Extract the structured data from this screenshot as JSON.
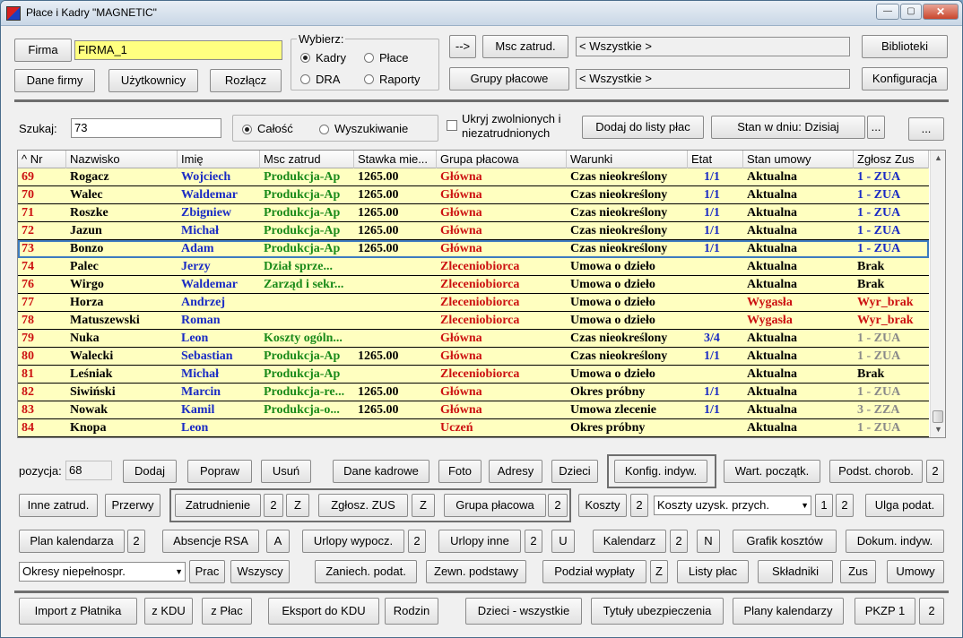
{
  "window": {
    "title": "Płace i Kadry \"MAGNETIC\"",
    "min": "—",
    "max": "▢",
    "close": "✕"
  },
  "top": {
    "firma_label": "Firma",
    "firma_value": "FIRMA_1",
    "dane_firmy": "Dane firmy",
    "uzytkownicy": "Użytkownicy",
    "rozlacz": "Rozłącz",
    "wybierz_label": "Wybierz:",
    "radio_kadry": "Kadry",
    "radio_place": "Płace",
    "radio_dra": "DRA",
    "radio_raporty": "Raporty",
    "arrow_btn": "-->",
    "msc_zatrud": "Msc zatrud.",
    "msc_value": "< Wszystkie >",
    "grupy_placowe": "Grupy płacowe",
    "grupy_value": "< Wszystkie >",
    "biblioteki": "Biblioteki",
    "konfiguracja": "Konfiguracja"
  },
  "search": {
    "label": "Szukaj:",
    "value": "73",
    "radio_calosc": "Całość",
    "radio_wyszukiwanie": "Wyszukiwanie",
    "ukryj_line1": "Ukryj zwolnionych i",
    "ukryj_line2": "niezatrudnionych",
    "dodaj_listy": "Dodaj do listy płac",
    "stan_w_dniu": "Stan w dniu: Dzisiaj",
    "dots1": "...",
    "dots2": "..."
  },
  "colors": {
    "nr": "#cc1111",
    "nazwisko": "#000000",
    "imie": "#1a2bc4",
    "msc": "#1a8a1a",
    "grupa": "#cc1111",
    "warunki": "#000000",
    "etat": "#1a2bc4",
    "stan_akt": "#000000",
    "stan_wyg": "#cc1111",
    "zus_blue": "#1a2bc4",
    "zus_gray": "#8a8a8a",
    "zus_black": "#000000",
    "zus_red": "#cc1111",
    "row_bg": "#ffffc0"
  },
  "grid": {
    "headers": [
      "^ Nr",
      "Nazwisko",
      "Imię",
      "Msc zatrud",
      "Stawka mie...",
      "Grupa płacowa",
      "Warunki",
      "Etat",
      "Stan umowy",
      "Zgłosz Zus"
    ],
    "rows": [
      {
        "nr": "69",
        "nazwisko": "Rogacz",
        "imie": "Wojciech",
        "msc": "Produkcja-Ap",
        "stawka": "1265.00",
        "grupa": "Główna",
        "warunki": "Czas nieokreślony",
        "etat": "1/1",
        "stan": "Aktualna",
        "zus": "1 - ZUA",
        "stan_style": "akt",
        "zus_style": "blue"
      },
      {
        "nr": "70",
        "nazwisko": "Walec",
        "imie": "Waldemar",
        "msc": "Produkcja-Ap",
        "stawka": "1265.00",
        "grupa": "Główna",
        "warunki": "Czas nieokreślony",
        "etat": "1/1",
        "stan": "Aktualna",
        "zus": "1 - ZUA",
        "stan_style": "akt",
        "zus_style": "blue"
      },
      {
        "nr": "71",
        "nazwisko": "Roszke",
        "imie": "Zbigniew",
        "msc": "Produkcja-Ap",
        "stawka": "1265.00",
        "grupa": "Główna",
        "warunki": "Czas nieokreślony",
        "etat": "1/1",
        "stan": "Aktualna",
        "zus": "1 - ZUA",
        "stan_style": "akt",
        "zus_style": "blue"
      },
      {
        "nr": "72",
        "nazwisko": "Jazun",
        "imie": "Michał",
        "msc": "Produkcja-Ap",
        "stawka": "1265.00",
        "grupa": "Główna",
        "warunki": "Czas nieokreślony",
        "etat": "1/1",
        "stan": "Aktualna",
        "zus": "1 - ZUA",
        "stan_style": "akt",
        "zus_style": "blue"
      },
      {
        "nr": "73",
        "nazwisko": "Bonzo",
        "imie": "Adam",
        "msc": "Produkcja-Ap",
        "stawka": "1265.00",
        "grupa": "Główna",
        "warunki": "Czas nieokreślony",
        "etat": "1/1",
        "stan": "Aktualna",
        "zus": "1 - ZUA",
        "stan_style": "akt",
        "zus_style": "blue",
        "selected": true
      },
      {
        "nr": "74",
        "nazwisko": "Palec",
        "imie": "Jerzy",
        "msc": "Dział sprze...",
        "stawka": "",
        "grupa": "Zleceniobiorca",
        "warunki": "Umowa o dzieło",
        "etat": "",
        "stan": "Aktualna",
        "zus": "Brak",
        "stan_style": "akt",
        "zus_style": "black"
      },
      {
        "nr": "76",
        "nazwisko": "Wirgo",
        "imie": "Waldemar",
        "msc": "Zarząd i sekr...",
        "stawka": "",
        "grupa": "Zleceniobiorca",
        "warunki": "Umowa o dzieło",
        "etat": "",
        "stan": "Aktualna",
        "zus": "Brak",
        "stan_style": "akt",
        "zus_style": "black"
      },
      {
        "nr": "77",
        "nazwisko": "Horza",
        "imie": "Andrzej",
        "msc": "",
        "stawka": "",
        "grupa": "Zleceniobiorca",
        "warunki": "Umowa o dzieło",
        "etat": "",
        "stan": "Wygasła",
        "zus": "Wyr_brak",
        "stan_style": "wyg",
        "zus_style": "red"
      },
      {
        "nr": "78",
        "nazwisko": "Matuszewski",
        "imie": "Roman",
        "msc": "",
        "stawka": "",
        "grupa": "Zleceniobiorca",
        "warunki": "Umowa o dzieło",
        "etat": "",
        "stan": "Wygasła",
        "zus": "Wyr_brak",
        "stan_style": "wyg",
        "zus_style": "red"
      },
      {
        "nr": "79",
        "nazwisko": "Nuka",
        "imie": "Leon",
        "msc": "Koszty ogóln...",
        "stawka": "",
        "grupa": "Główna",
        "warunki": "Czas nieokreślony",
        "etat": "3/4",
        "stan": "Aktualna",
        "zus": "1 - ZUA",
        "stan_style": "akt",
        "zus_style": "gray"
      },
      {
        "nr": "80",
        "nazwisko": "Walecki",
        "imie": "Sebastian",
        "msc": "Produkcja-Ap",
        "stawka": "1265.00",
        "grupa": "Główna",
        "warunki": "Czas nieokreślony",
        "etat": "1/1",
        "stan": "Aktualna",
        "zus": "1 - ZUA",
        "stan_style": "akt",
        "zus_style": "gray"
      },
      {
        "nr": "81",
        "nazwisko": "Leśniak",
        "imie": "Michał",
        "msc": "Produkcja-Ap",
        "stawka": "",
        "grupa": "Zleceniobiorca",
        "warunki": "Umowa o dzieło",
        "etat": "",
        "stan": "Aktualna",
        "zus": "Brak",
        "stan_style": "akt",
        "zus_style": "black"
      },
      {
        "nr": "82",
        "nazwisko": "Siwiński",
        "imie": "Marcin",
        "msc": "Produkcja-re...",
        "stawka": "1265.00",
        "grupa": "Główna",
        "warunki": "Okres próbny",
        "etat": "1/1",
        "stan": "Aktualna",
        "zus": "1 - ZUA",
        "stan_style": "akt",
        "zus_style": "gray"
      },
      {
        "nr": "83",
        "nazwisko": "Nowak",
        "imie": "Kamil",
        "msc": "Produkcja-o...",
        "stawka": "1265.00",
        "grupa": "Główna",
        "warunki": "Umowa zlecenie",
        "etat": "1/1",
        "stan": "Aktualna",
        "zus": "3 - ZZA",
        "stan_style": "akt",
        "zus_style": "gray"
      },
      {
        "nr": "84",
        "nazwisko": "Knopa",
        "imie": "Leon",
        "msc": "",
        "stawka": "",
        "grupa": "Uczeń",
        "warunki": "Okres próbny",
        "etat": "",
        "stan": "Aktualna",
        "zus": "1 - ZUA",
        "stan_style": "akt",
        "zus_style": "gray"
      }
    ]
  },
  "bottom": {
    "pozycja_label": "pozycja:",
    "pozycja_value": "68",
    "dodaj": "Dodaj",
    "popraw": "Popraw",
    "usun": "Usuń",
    "dane_kadrowe": "Dane kadrowe",
    "foto": "Foto",
    "adresy": "Adresy",
    "dzieci": "Dzieci",
    "konfig_indyw": "Konfig. indyw.",
    "wart_poczatk": "Wart. początk.",
    "podst_chorob": "Podst. chorob.",
    "n2a": "2",
    "inne_zatrud": "Inne zatrud.",
    "przerwy": "Przerwy",
    "zatrudnienie": "Zatrudnienie",
    "n2b": "2",
    "z1": "Z",
    "zglosz_zus": "Zgłosz. ZUS",
    "z2": "Z",
    "grupa_placowa": "Grupa płacowa",
    "n2c": "2",
    "koszty": "Koszty",
    "n2d": "2",
    "koszty_select": "Koszty uzysk. przych.",
    "n1e": "1",
    "n2e": "2",
    "ulga_podat": "Ulga podat.",
    "plan_kalendarza": "Plan kalendarza",
    "n2f": "2",
    "absencje_rsa": "Absencje RSA",
    "a": "A",
    "urlopy_wypocz": "Urlopy wypocz.",
    "n2g": "2",
    "urlopy_inne": "Urlopy inne",
    "n2h": "2",
    "u": "U",
    "kalendarz": "Kalendarz",
    "n2i": "2",
    "n": "N",
    "grafik_kosztow": "Grafik kosztów",
    "dokum_indyw": "Dokum. indyw.",
    "okresy_select": "Okresy niepełnospr.",
    "prac": "Prac",
    "wszyscy": "Wszyscy",
    "zaniech_podat": "Zaniech. podat.",
    "zewn_podstawy": "Zewn. podstawy",
    "podzial_wyplaty": "Podział wypłaty",
    "z3": "Z",
    "listy_plac": "Listy płac",
    "skladniki": "Składniki",
    "zus": "Zus",
    "umowy": "Umowy",
    "import_platnika": "Import z Płatnika",
    "z_kdu": "z KDU",
    "z_plac": "z Płac",
    "eksport_kdu": "Eksport do KDU",
    "rodzin": "Rodzin",
    "dzieci_wszystkie": "Dzieci - wszystkie",
    "tytuly_ubezp": "Tytuły ubezpieczenia",
    "plany_kalendarzy": "Plany kalendarzy",
    "pkzp1": "PKZP 1",
    "n2j": "2"
  }
}
